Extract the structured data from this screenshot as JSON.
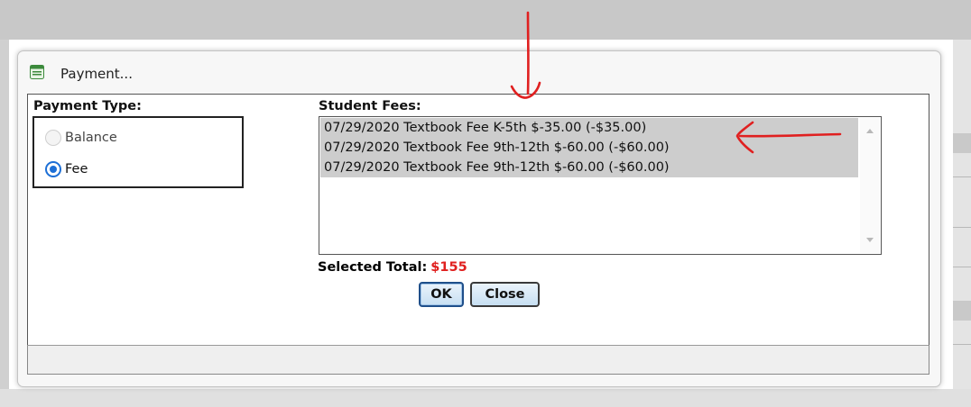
{
  "dialog": {
    "title": "Payment...",
    "icon": "window-form-icon"
  },
  "payment_type": {
    "label": "Payment Type:",
    "options": [
      {
        "label": "Balance",
        "selected": false,
        "disabled": true
      },
      {
        "label": "Fee",
        "selected": true,
        "disabled": false
      }
    ]
  },
  "student_fees": {
    "label": "Student Fees:",
    "items": [
      "07/29/2020 Textbook Fee K-5th $-35.00 (-$35.00)",
      "07/29/2020 Textbook Fee 9th-12th $-60.00 (-$60.00)",
      "07/29/2020 Textbook Fee 9th-12th $-60.00 (-$60.00)"
    ]
  },
  "selected_total": {
    "label": "Selected Total:",
    "value": "$155"
  },
  "buttons": {
    "ok": "OK",
    "close": "Close"
  },
  "colors": {
    "total_value": "#e0201f",
    "annotation_arrows": "#e02020",
    "radio_selected": "#1d6fd6",
    "list_selected_bg": "#cdcdcd"
  }
}
